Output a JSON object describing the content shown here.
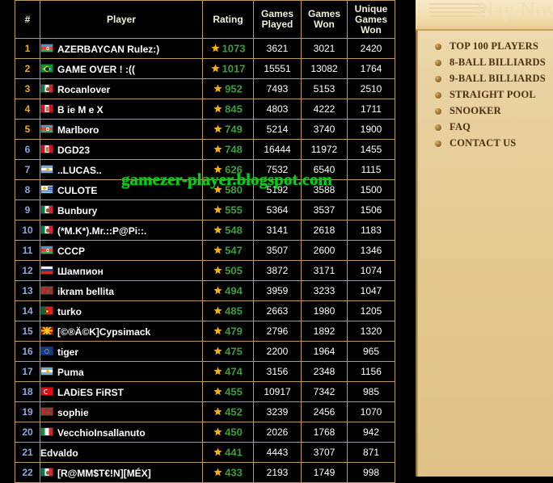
{
  "table": {
    "headers": [
      "#",
      "Player",
      "Rating",
      "Games Played",
      "Games Won",
      "Unique Games Won"
    ],
    "rows": [
      {
        "rank": "1",
        "flag": "az",
        "player": "AZERBAYCAN Rulez:)",
        "rating": "1073",
        "played": "3621",
        "won": "3021",
        "unique": "2420"
      },
      {
        "rank": "2",
        "flag": "br",
        "player": "GAME OVER ! :((",
        "rating": "1017",
        "played": "15551",
        "won": "13082",
        "unique": "1764"
      },
      {
        "rank": "3",
        "flag": "mx",
        "player": "Rocanlover",
        "rating": "952",
        "played": "7493",
        "won": "5153",
        "unique": "2510"
      },
      {
        "rank": "4",
        "flag": "pe",
        "player": "B ie M e X",
        "rating": "845",
        "played": "4803",
        "won": "4222",
        "unique": "1711"
      },
      {
        "rank": "5",
        "flag": "az",
        "player": "Marlboro",
        "rating": "749",
        "played": "5214",
        "won": "3740",
        "unique": "1900"
      },
      {
        "rank": "6",
        "flag": "pe",
        "player": "DGD23",
        "rating": "748",
        "played": "16444",
        "won": "11972",
        "unique": "1455"
      },
      {
        "rank": "7",
        "flag": "ar",
        "player": "..LUCAS..",
        "rating": "626",
        "played": "7532",
        "won": "6540",
        "unique": "1115"
      },
      {
        "rank": "8",
        "flag": "uy",
        "player": "CULOTE",
        "rating": "580",
        "played": "5192",
        "won": "3588",
        "unique": "1500"
      },
      {
        "rank": "9",
        "flag": "mx",
        "player": "Bunbury",
        "rating": "555",
        "played": "5364",
        "won": "3537",
        "unique": "1506"
      },
      {
        "rank": "10",
        "flag": "mx",
        "player": "(*M.K*).Mr.::P@Pi::.",
        "rating": "548",
        "played": "3141",
        "won": "2618",
        "unique": "1183"
      },
      {
        "rank": "11",
        "flag": "az",
        "player": "CCCP",
        "rating": "547",
        "played": "3507",
        "won": "2600",
        "unique": "1346"
      },
      {
        "rank": "12",
        "flag": "ru",
        "player": "Шампион",
        "rating": "505",
        "played": "3872",
        "won": "3171",
        "unique": "1074"
      },
      {
        "rank": "13",
        "flag": "ma",
        "player": "ikram bellita",
        "rating": "494",
        "played": "3959",
        "won": "3233",
        "unique": "1047"
      },
      {
        "rank": "14",
        "flag": "pt",
        "player": "turko",
        "rating": "485",
        "played": "2663",
        "won": "1980",
        "unique": "1205"
      },
      {
        "rank": "15",
        "flag": "mk",
        "player": "[©®Ä©K]Cypsimack",
        "rating": "479",
        "played": "2796",
        "won": "1892",
        "unique": "1320"
      },
      {
        "rank": "16",
        "flag": "eu",
        "player": "tiger",
        "rating": "475",
        "played": "2200",
        "won": "1964",
        "unique": "965"
      },
      {
        "rank": "17",
        "flag": "ar",
        "player": "Puma",
        "rating": "474",
        "played": "3156",
        "won": "2348",
        "unique": "1156"
      },
      {
        "rank": "18",
        "flag": "tr",
        "player": "LADiES FiRST",
        "rating": "455",
        "played": "10917",
        "won": "7342",
        "unique": "985"
      },
      {
        "rank": "19",
        "flag": "ma",
        "player": "sophie",
        "rating": "452",
        "played": "3239",
        "won": "2456",
        "unique": "1070"
      },
      {
        "rank": "20",
        "flag": "it",
        "player": "VecchioInsallanuto",
        "rating": "450",
        "played": "2026",
        "won": "1768",
        "unique": "942"
      },
      {
        "rank": "21",
        "flag": "none",
        "player": "Edvaldo",
        "rating": "441",
        "played": "4443",
        "won": "3707",
        "unique": "871"
      },
      {
        "rank": "22",
        "flag": "mx",
        "player": "[R@MM$T€!N][MÉX]",
        "rating": "433",
        "played": "2193",
        "won": "1749",
        "unique": "998"
      }
    ]
  },
  "watermark": {
    "text": "gamezer-player.blogspot.com",
    "color": "#00d21a"
  },
  "sidebar": {
    "header": {
      "title": "Play Now"
    },
    "items": [
      {
        "label": "TOP 100 PLAYERS"
      },
      {
        "label": "8-BALL BILLIARDS"
      },
      {
        "label": "9-BALL BILLIARDS"
      },
      {
        "label": "STRAIGHT POOL"
      },
      {
        "label": "SNOOKER"
      },
      {
        "label": "FAQ"
      },
      {
        "label": "CONTACT US"
      }
    ]
  },
  "colors": {
    "page_bg": "#000000",
    "table_border": "#b99a5a",
    "rank_gold": "#f0a81e",
    "rank_blue": "#8fa8e0",
    "rating_green": "#3e9c3e",
    "star_gold": "#f5b10a",
    "sidebar_bg_top": "#f2e0b8",
    "sidebar_bg_bottom": "#e0c288",
    "sidebar_text": "#4e2d10"
  }
}
